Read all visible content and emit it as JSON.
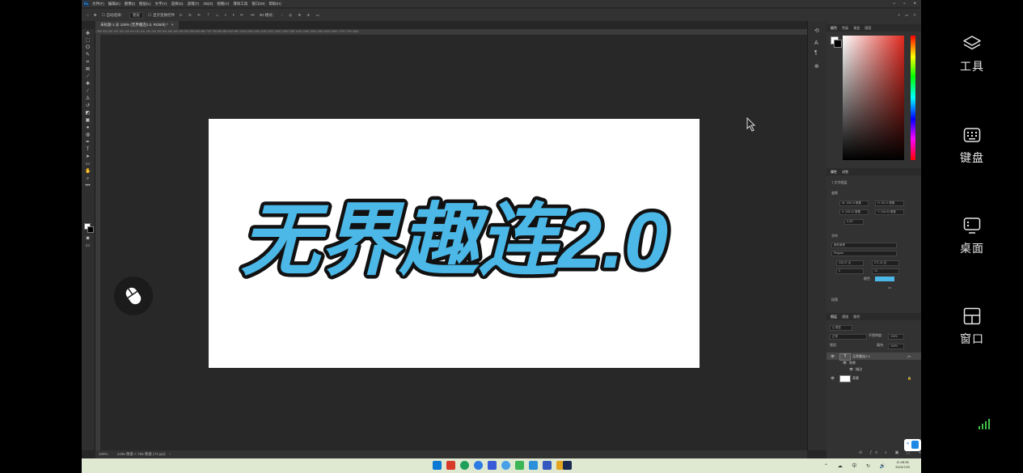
{
  "menubar": {
    "logo": "Ps",
    "items": [
      "文件(F)",
      "编辑(E)",
      "图像(I)",
      "图层(L)",
      "文字(Y)",
      "选择(S)",
      "滤镜(T)",
      "3D(D)",
      "视图(V)",
      "增效工具",
      "窗口(W)",
      "帮助(H)"
    ],
    "window_controls": [
      "−",
      "▫",
      "×"
    ]
  },
  "options_bar": {
    "auto_select_label": "自动选择：",
    "auto_select_value": "图层",
    "show_transform_label": "显示变换控件",
    "mode_3d_label": "3D 模式："
  },
  "document_tab": {
    "title": "未标题-1 @ 100% (无界趣连2.0, RGB/8) *",
    "close": "×"
  },
  "ruler_ticks": "| 350   300   250   200   150   100   50   0   50   100   150   200   250   300   350   400   450   500   550   600   650   700   750   800   850   900   950   1000   1050   1100   1150   1200   1250   1300   1350   1400   1450   1500   1550   1600   1650   1700   1750   1800",
  "canvas": {
    "headline": "无界趣连2.0",
    "text_color": "#4cb8e8",
    "stroke_color": "#111111"
  },
  "status_bar": {
    "zoom": "100%",
    "doc_info": "1495 像素 × 755 像素 (72 ppi)",
    "arrow": "›"
  },
  "color_panel": {
    "tabs": [
      "颜色",
      "色板",
      "渐变",
      "图案"
    ]
  },
  "properties_panel": {
    "tabs": [
      "属性",
      "调整"
    ],
    "layer_kind": "文字图层",
    "transform_section": "变换",
    "w": "W: 1061.8 像素",
    "h": "H: 181.3 像素",
    "x": "X: 245.22 像素",
    "y": "Y: 246.93 像素",
    "angle": "0.00°",
    "character_section": "字符",
    "font_family": "微软雅黑",
    "font_style": "Regular",
    "font_size": "225.37 点",
    "leading": "271.22 点",
    "tracking": "0",
    "kerning": "10",
    "color_label": "颜色",
    "paragraph_section": "段落",
    "more": "•••"
  },
  "layers_panel": {
    "tabs": [
      "图层",
      "通道",
      "路径"
    ],
    "filter_label": "Q 类型",
    "blend_mode": "正常",
    "opacity_label": "不透明度:",
    "opacity_value": "100%",
    "lock_label": "锁定:",
    "fill_label": "填充:",
    "fill_value": "100%",
    "layers": [
      {
        "name": "无界趣连2.0",
        "type": "text",
        "selected": true
      },
      {
        "name": "效果",
        "type": "effects"
      },
      {
        "name": "描边",
        "type": "effect"
      },
      {
        "name": "背景",
        "type": "background"
      }
    ]
  },
  "side_panel": {
    "buttons": [
      {
        "label": "工具",
        "icon": "layers-icon"
      },
      {
        "label": "键盘",
        "icon": "keyboard-icon"
      },
      {
        "label": "桌面",
        "icon": "desktop-icon"
      },
      {
        "label": "窗口",
        "icon": "window-grid-icon"
      }
    ]
  },
  "taskbar": {
    "time": "11:28:36",
    "date": "2024/7/29"
  },
  "colors": {
    "ps_bg": "#262626",
    "panel_bg": "#323232",
    "accent_blue": "#4cb8e8",
    "taskbar": "#dfe8d0",
    "signal_green": "#3ec14a"
  }
}
